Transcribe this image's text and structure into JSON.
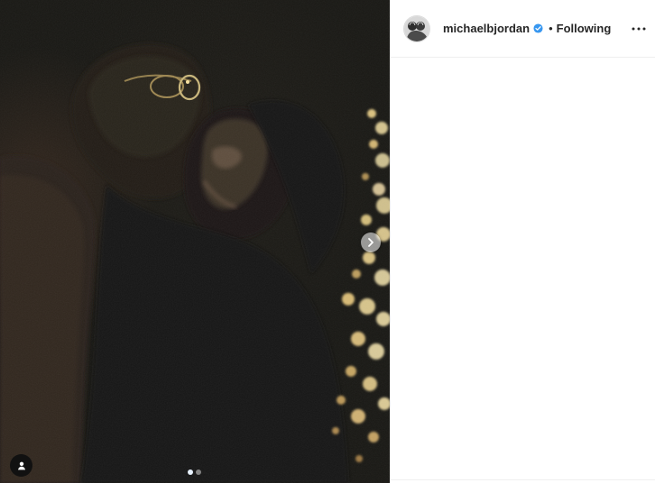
{
  "post": {
    "header": {
      "username": "michaelbjordan",
      "verified": true,
      "separator": "•",
      "follow_status": "Following",
      "more_icon": "more-horizontal-icon"
    },
    "media": {
      "description_icon": "photo",
      "next_icon": "chevron-right-icon",
      "tagged_icon": "person-tag-icon",
      "carousel": {
        "total": 2,
        "current": 1
      }
    }
  },
  "colors": {
    "text": "#262626",
    "verified": "#3897f0",
    "border": "#efefef",
    "photo_bg": "#1d1b15",
    "bokeh": "#f3dd9a"
  }
}
